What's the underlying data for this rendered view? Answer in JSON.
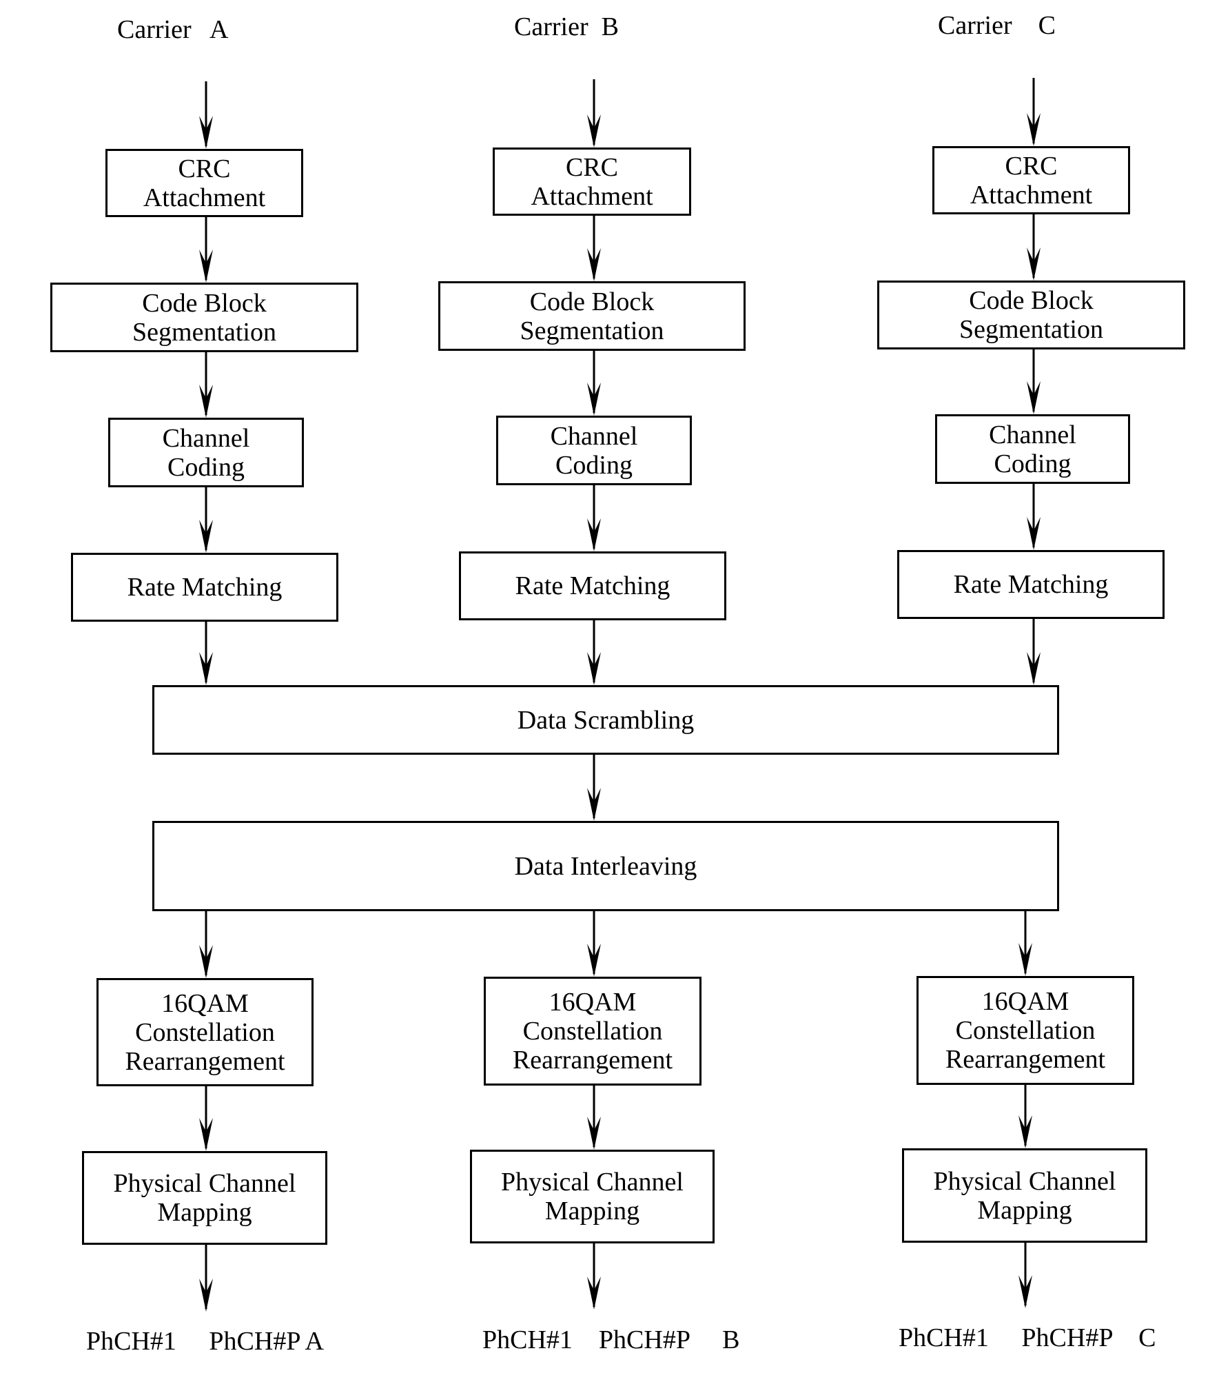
{
  "carriers": [
    {
      "id": "A",
      "title": "Carrier   A",
      "outputs": "PhCH#1     PhCH#P A"
    },
    {
      "id": "B",
      "title": "Carrier  B",
      "outputs": "PhCH#1    PhCH#P     B"
    },
    {
      "id": "C",
      "title": "Carrier    C",
      "outputs": "PhCH#1     PhCH#P    C"
    }
  ],
  "stages": {
    "crc": [
      "CRC",
      "Attachment"
    ],
    "cbs": [
      "Code Block",
      "Segmentation"
    ],
    "cc": [
      "Channel",
      "Coding"
    ],
    "rm": [
      "Rate Matching"
    ],
    "qam": [
      "16QAM",
      "Constellation",
      "Rearrangement"
    ],
    "pcm": [
      "Physical Channel",
      "Mapping"
    ]
  },
  "shared": {
    "scrambling": "Data Scrambling",
    "interleaving": "Data Interleaving"
  }
}
